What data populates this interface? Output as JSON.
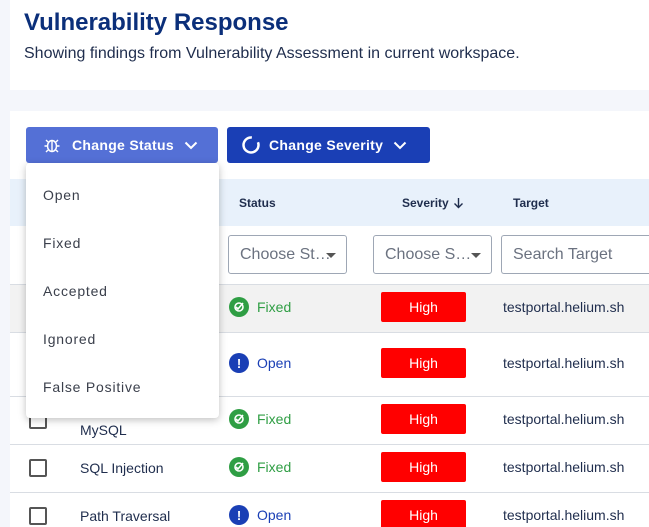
{
  "header": {
    "title": "Vulnerability Response",
    "subtitle": "Showing findings from Vulnerability Assessment in current workspace."
  },
  "toolbar": {
    "change_status_label": "Change Status",
    "change_severity_label": "Change Severity"
  },
  "status_menu": {
    "items": [
      "Open",
      "Fixed",
      "Accepted",
      "Ignored",
      "False Positive"
    ]
  },
  "table": {
    "columns": {
      "status": "Status",
      "severity": "Severity",
      "target": "Target"
    },
    "filters": {
      "status_placeholder": "Choose St…",
      "severity_placeholder": "Choose S…",
      "target_placeholder": "Search Target"
    },
    "rows": [
      {
        "name": "",
        "status": "Fixed",
        "severity": "High",
        "target": "testportal.helium.sh"
      },
      {
        "name": "",
        "status": "Open",
        "severity": "High",
        "target": "testportal.helium.sh"
      },
      {
        "name": "MySQL",
        "status": "Fixed",
        "severity": "High",
        "target": "testportal.helium.sh"
      },
      {
        "name": "SQL Injection",
        "status": "Fixed",
        "severity": "High",
        "target": "testportal.helium.sh"
      },
      {
        "name": "Path Traversal",
        "status": "Open",
        "severity": "High",
        "target": "testportal.helium.sh"
      }
    ]
  },
  "colors": {
    "title": "#0b2f7a",
    "change_status_btn": "#5470d6",
    "change_severity_btn": "#1a3fb5",
    "severity_high": "#ff0000",
    "status_fixed": "#2f9e44",
    "status_open": "#1a3fb5",
    "table_header_bg": "#e8f1fb"
  },
  "icons": {
    "change_status": "bug-icon",
    "change_severity": "circle-progress-icon",
    "fixed": "fixed-check-icon",
    "open": "exclamation-icon",
    "sort": "arrow-down-icon"
  }
}
